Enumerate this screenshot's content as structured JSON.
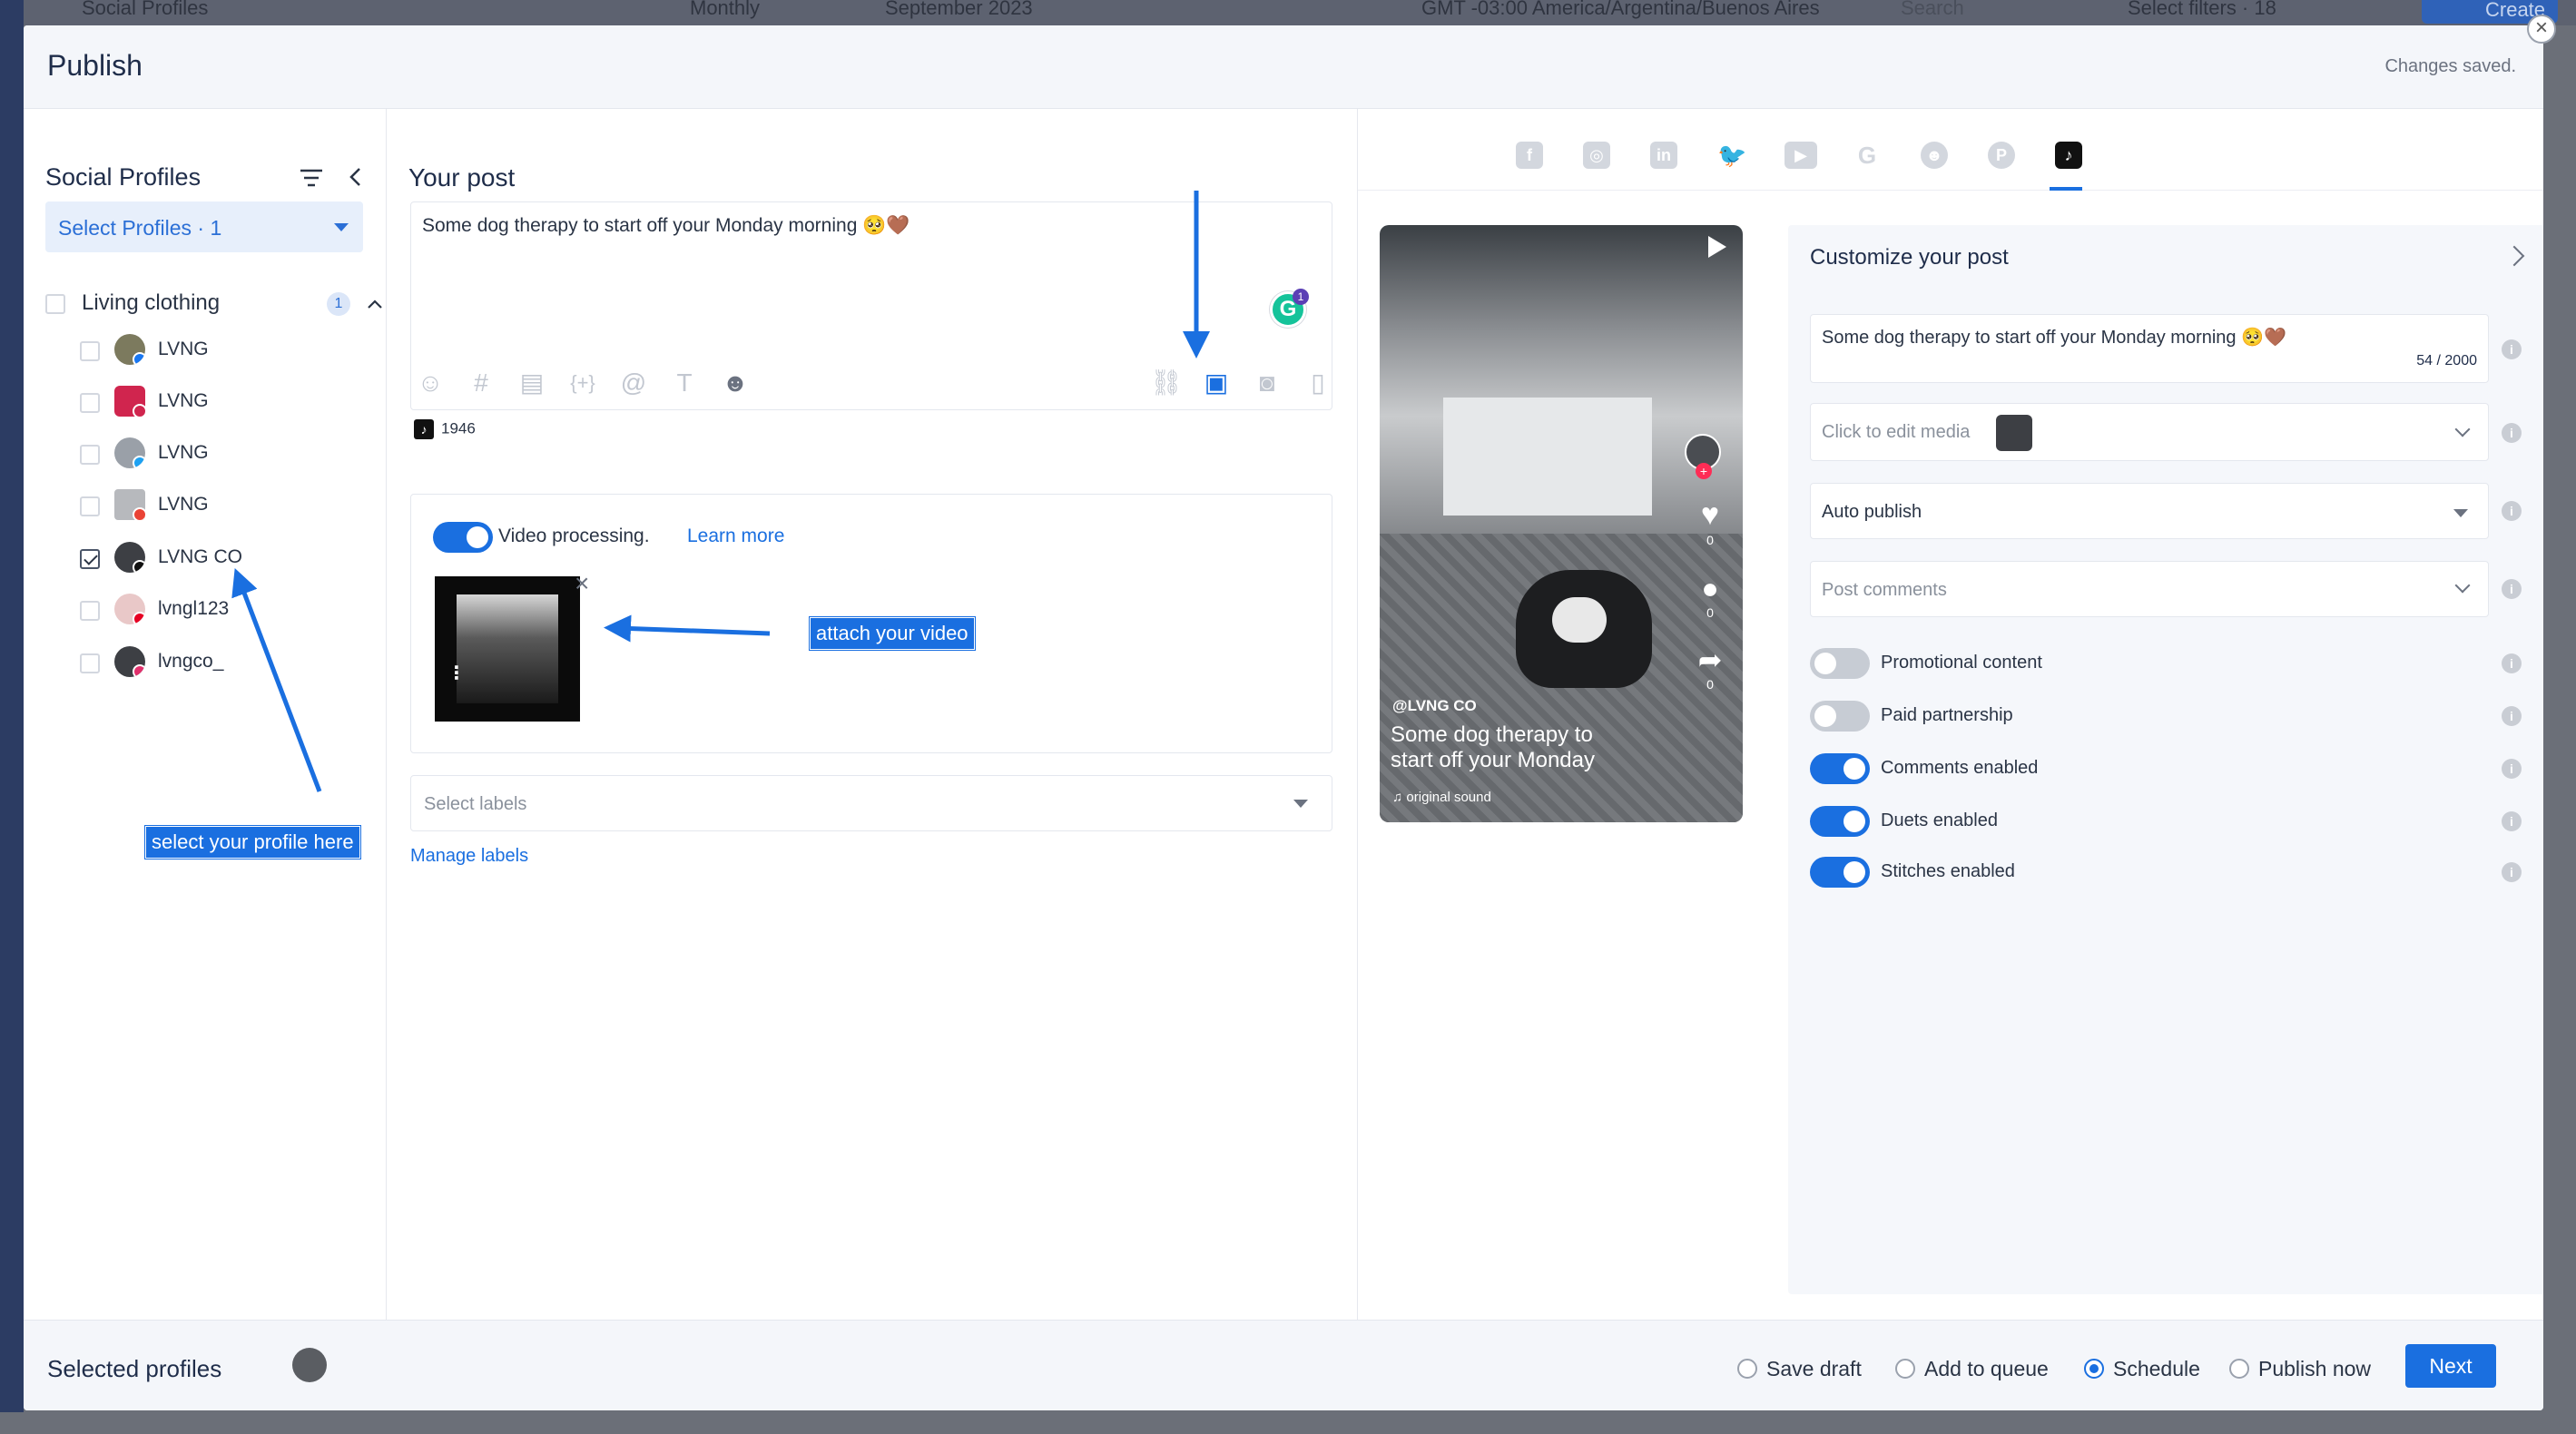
{
  "background": {
    "top_bar_texts": [
      "Social Profiles",
      "Monthly",
      "September 2023",
      "GMT -03:00 America/Argentina/Buenos Aires",
      "Search",
      "Select filters · 18",
      "Create"
    ]
  },
  "modal": {
    "title": "Publish",
    "status": "Changes saved.",
    "close_glyph": "×"
  },
  "social_profiles": {
    "title": "Social Profiles",
    "select_label": "Select Profiles · 1",
    "group": {
      "label": "Living clothing",
      "count": "1"
    },
    "profiles": [
      {
        "name": "LVNG",
        "network": "facebook",
        "checked": false
      },
      {
        "name": "LVNG",
        "network": "lemon8",
        "checked": false
      },
      {
        "name": "LVNG",
        "network": "twitter",
        "checked": false
      },
      {
        "name": "LVNG",
        "network": "google",
        "checked": false
      },
      {
        "name": "LVNG CO",
        "network": "tiktok",
        "checked": true
      },
      {
        "name": "lvngl123",
        "network": "pinterest",
        "checked": false
      },
      {
        "name": "lvngco_",
        "network": "instagram",
        "checked": false
      }
    ]
  },
  "your_post": {
    "title": "Your post",
    "text": "Some dog therapy to start off your Monday morning 🥺🤎",
    "grammarly_badge": "1",
    "grammarly_letter": "G",
    "tiktok_char_count": "1946",
    "video_processing_label": "Video processing.",
    "learn_more": "Learn more",
    "video_processing_on": true,
    "labels_placeholder": "Select labels",
    "manage_labels": "Manage labels"
  },
  "annotations": {
    "attach_video": "attach your video",
    "select_profile": "select your profile here"
  },
  "network_tabs": [
    "facebook",
    "instagram",
    "linkedin",
    "twitter",
    "youtube",
    "google",
    "reddit",
    "pinterest",
    "tiktok"
  ],
  "active_tab": "tiktok",
  "preview": {
    "handle": "@LVNG CO",
    "caption": "Some dog therapy to start off your Monday",
    "sound": "♫  original sound",
    "likes": "0",
    "comments": "0",
    "shares": "0"
  },
  "customize": {
    "title": "Customize your post",
    "text": "Some dog therapy to start off your Monday morning 🥺🤎",
    "char_count": "54 / 2000",
    "media_label": "Click to edit media",
    "publish_mode": "Auto publish",
    "comments_placeholder": "Post comments",
    "options": [
      {
        "label": "Promotional content",
        "on": false
      },
      {
        "label": "Paid partnership",
        "on": false
      },
      {
        "label": "Comments enabled",
        "on": true
      },
      {
        "label": "Duets enabled",
        "on": true
      },
      {
        "label": "Stitches enabled",
        "on": true
      }
    ]
  },
  "footer": {
    "selected_profiles": "Selected profiles",
    "options": [
      {
        "label": "Save draft",
        "selected": false
      },
      {
        "label": "Add to queue",
        "selected": false
      },
      {
        "label": "Schedule",
        "selected": true
      },
      {
        "label": "Publish now",
        "selected": false
      }
    ],
    "next": "Next"
  },
  "colors": {
    "accent": "#1a6fe0",
    "tiktok": "#111111",
    "toggle_off": "#c7ccd4"
  }
}
